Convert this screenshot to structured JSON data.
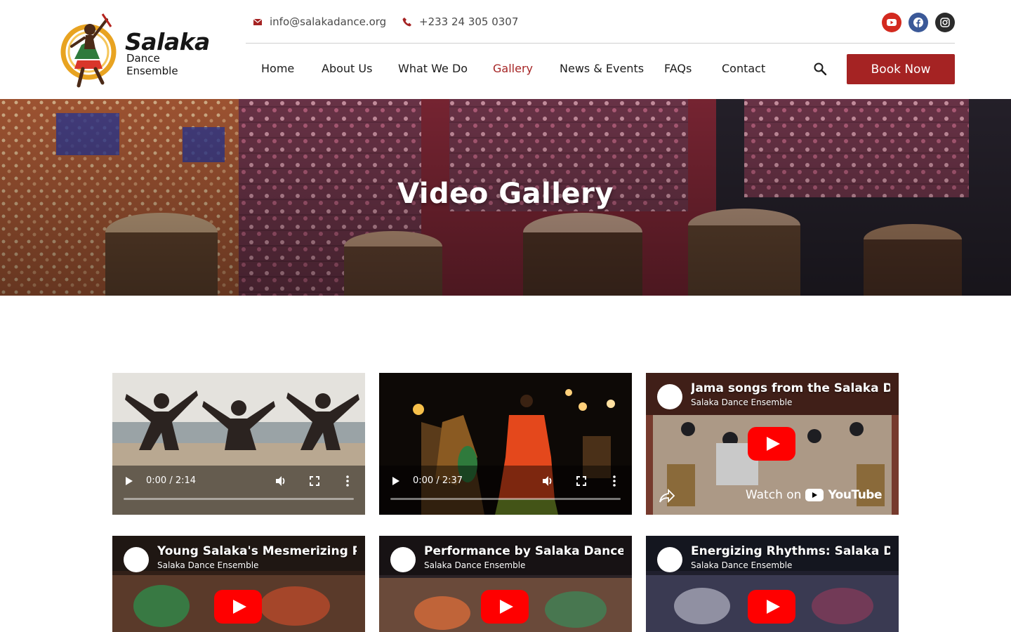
{
  "header": {
    "logo": {
      "name": "Salaka",
      "subtitle": "Dance Ensemble"
    },
    "contact": {
      "email": "info@salakadance.org",
      "phone": "+233 24 305 0307"
    },
    "socials": [
      {
        "name": "youtube-icon",
        "color": "#d32a1f"
      },
      {
        "name": "facebook-icon",
        "color": "#3b5998"
      },
      {
        "name": "instagram-icon",
        "color": "#2b2b2b"
      }
    ],
    "nav": [
      {
        "label": "Home",
        "active": false
      },
      {
        "label": "About Us",
        "active": false
      },
      {
        "label": "What We Do",
        "active": false
      },
      {
        "label": "Gallery",
        "active": true
      },
      {
        "label": "News & Events",
        "active": false
      },
      {
        "label": "FAQs",
        "active": false
      },
      {
        "label": "Contact",
        "active": false
      }
    ],
    "book_label": "Book Now"
  },
  "hero": {
    "title": "Video Gallery"
  },
  "videos": [
    {
      "kind": "html5",
      "time": "0:00 / 2:14"
    },
    {
      "kind": "html5",
      "time": "0:00 / 2:37"
    },
    {
      "kind": "youtube",
      "title": "Jama songs from the Salaka Dance Ensemble",
      "channel": "Salaka Dance Ensemble",
      "watch_label": "Watch on",
      "brand": "YouTube"
    },
    {
      "kind": "youtube",
      "title": "Young Salaka's Mesmerizing Performance",
      "channel": "Salaka Dance Ensemble"
    },
    {
      "kind": "youtube",
      "title": "Performance by Salaka Dance Ensemble",
      "channel": "Salaka Dance Ensemble"
    },
    {
      "kind": "youtube",
      "title": "Energizing Rhythms: Salaka Dance Ensemble",
      "channel": "Salaka Dance Ensemble"
    }
  ],
  "colors": {
    "accent": "#a52323",
    "yt_red": "#ff0000"
  }
}
